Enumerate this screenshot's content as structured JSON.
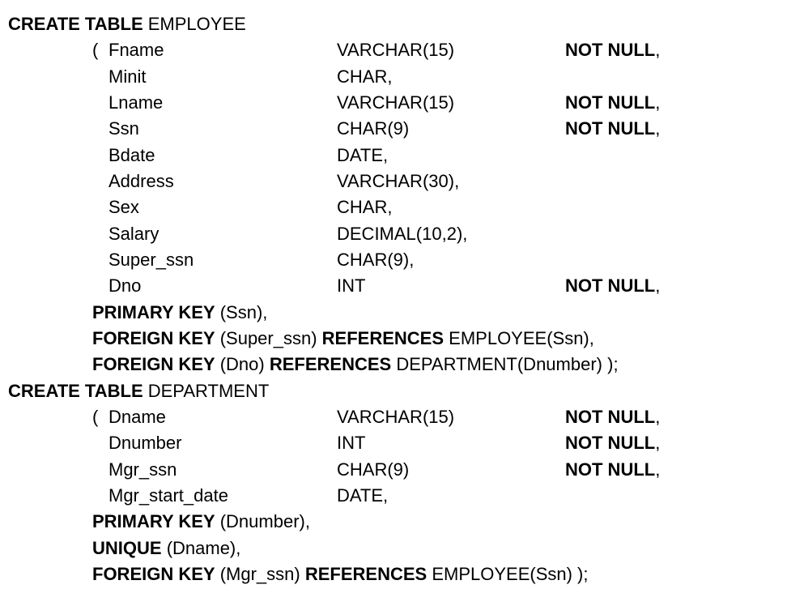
{
  "keywords": {
    "create_table": "CREATE TABLE",
    "primary_key": "PRIMARY KEY",
    "foreign_key": "FOREIGN KEY",
    "references": "REFERENCES",
    "unique": "UNIQUE",
    "not_null": "NOT NULL"
  },
  "tables": [
    {
      "name": "EMPLOYEE",
      "columns": [
        {
          "name": "Fname",
          "type": "VARCHAR(15)",
          "not_null": true
        },
        {
          "name": "Minit",
          "type": "CHAR,",
          "not_null": false
        },
        {
          "name": "Lname",
          "type": "VARCHAR(15)",
          "not_null": true
        },
        {
          "name": "Ssn",
          "type": "CHAR(9)",
          "not_null": true
        },
        {
          "name": "Bdate",
          "type": "DATE,",
          "not_null": false
        },
        {
          "name": "Address",
          "type": "VARCHAR(30),",
          "not_null": false
        },
        {
          "name": "Sex",
          "type": "CHAR,",
          "not_null": false
        },
        {
          "name": "Salary",
          "type": "DECIMAL(10,2),",
          "not_null": false
        },
        {
          "name": "Super_ssn",
          "type": "CHAR(9),",
          "not_null": false
        },
        {
          "name": "Dno",
          "type": "INT",
          "not_null": true
        }
      ],
      "constraints": [
        {
          "kind": "primary_key",
          "cols": "(Ssn)",
          "trailing": ","
        },
        {
          "kind": "foreign_key",
          "cols": "(Super_ssn)",
          "ref": "EMPLOYEE(Ssn)",
          "trailing": ","
        },
        {
          "kind": "foreign_key",
          "cols": "(Dno)",
          "ref": "DEPARTMENT(Dnumber)",
          "trailing": " );"
        }
      ]
    },
    {
      "name": "DEPARTMENT",
      "columns": [
        {
          "name": "Dname",
          "type": "VARCHAR(15)",
          "not_null": true
        },
        {
          "name": "Dnumber",
          "type": "INT",
          "not_null": true
        },
        {
          "name": "Mgr_ssn",
          "type": "CHAR(9)",
          "not_null": true
        },
        {
          "name": "Mgr_start_date",
          "type": "DATE,",
          "not_null": false
        }
      ],
      "constraints": [
        {
          "kind": "primary_key",
          "cols": "(Dnumber)",
          "trailing": ","
        },
        {
          "kind": "unique",
          "cols": "(Dname)",
          "trailing": ","
        },
        {
          "kind": "foreign_key",
          "cols": "(Mgr_ssn)",
          "ref": "EMPLOYEE(Ssn)",
          "trailing": " );"
        }
      ]
    }
  ]
}
